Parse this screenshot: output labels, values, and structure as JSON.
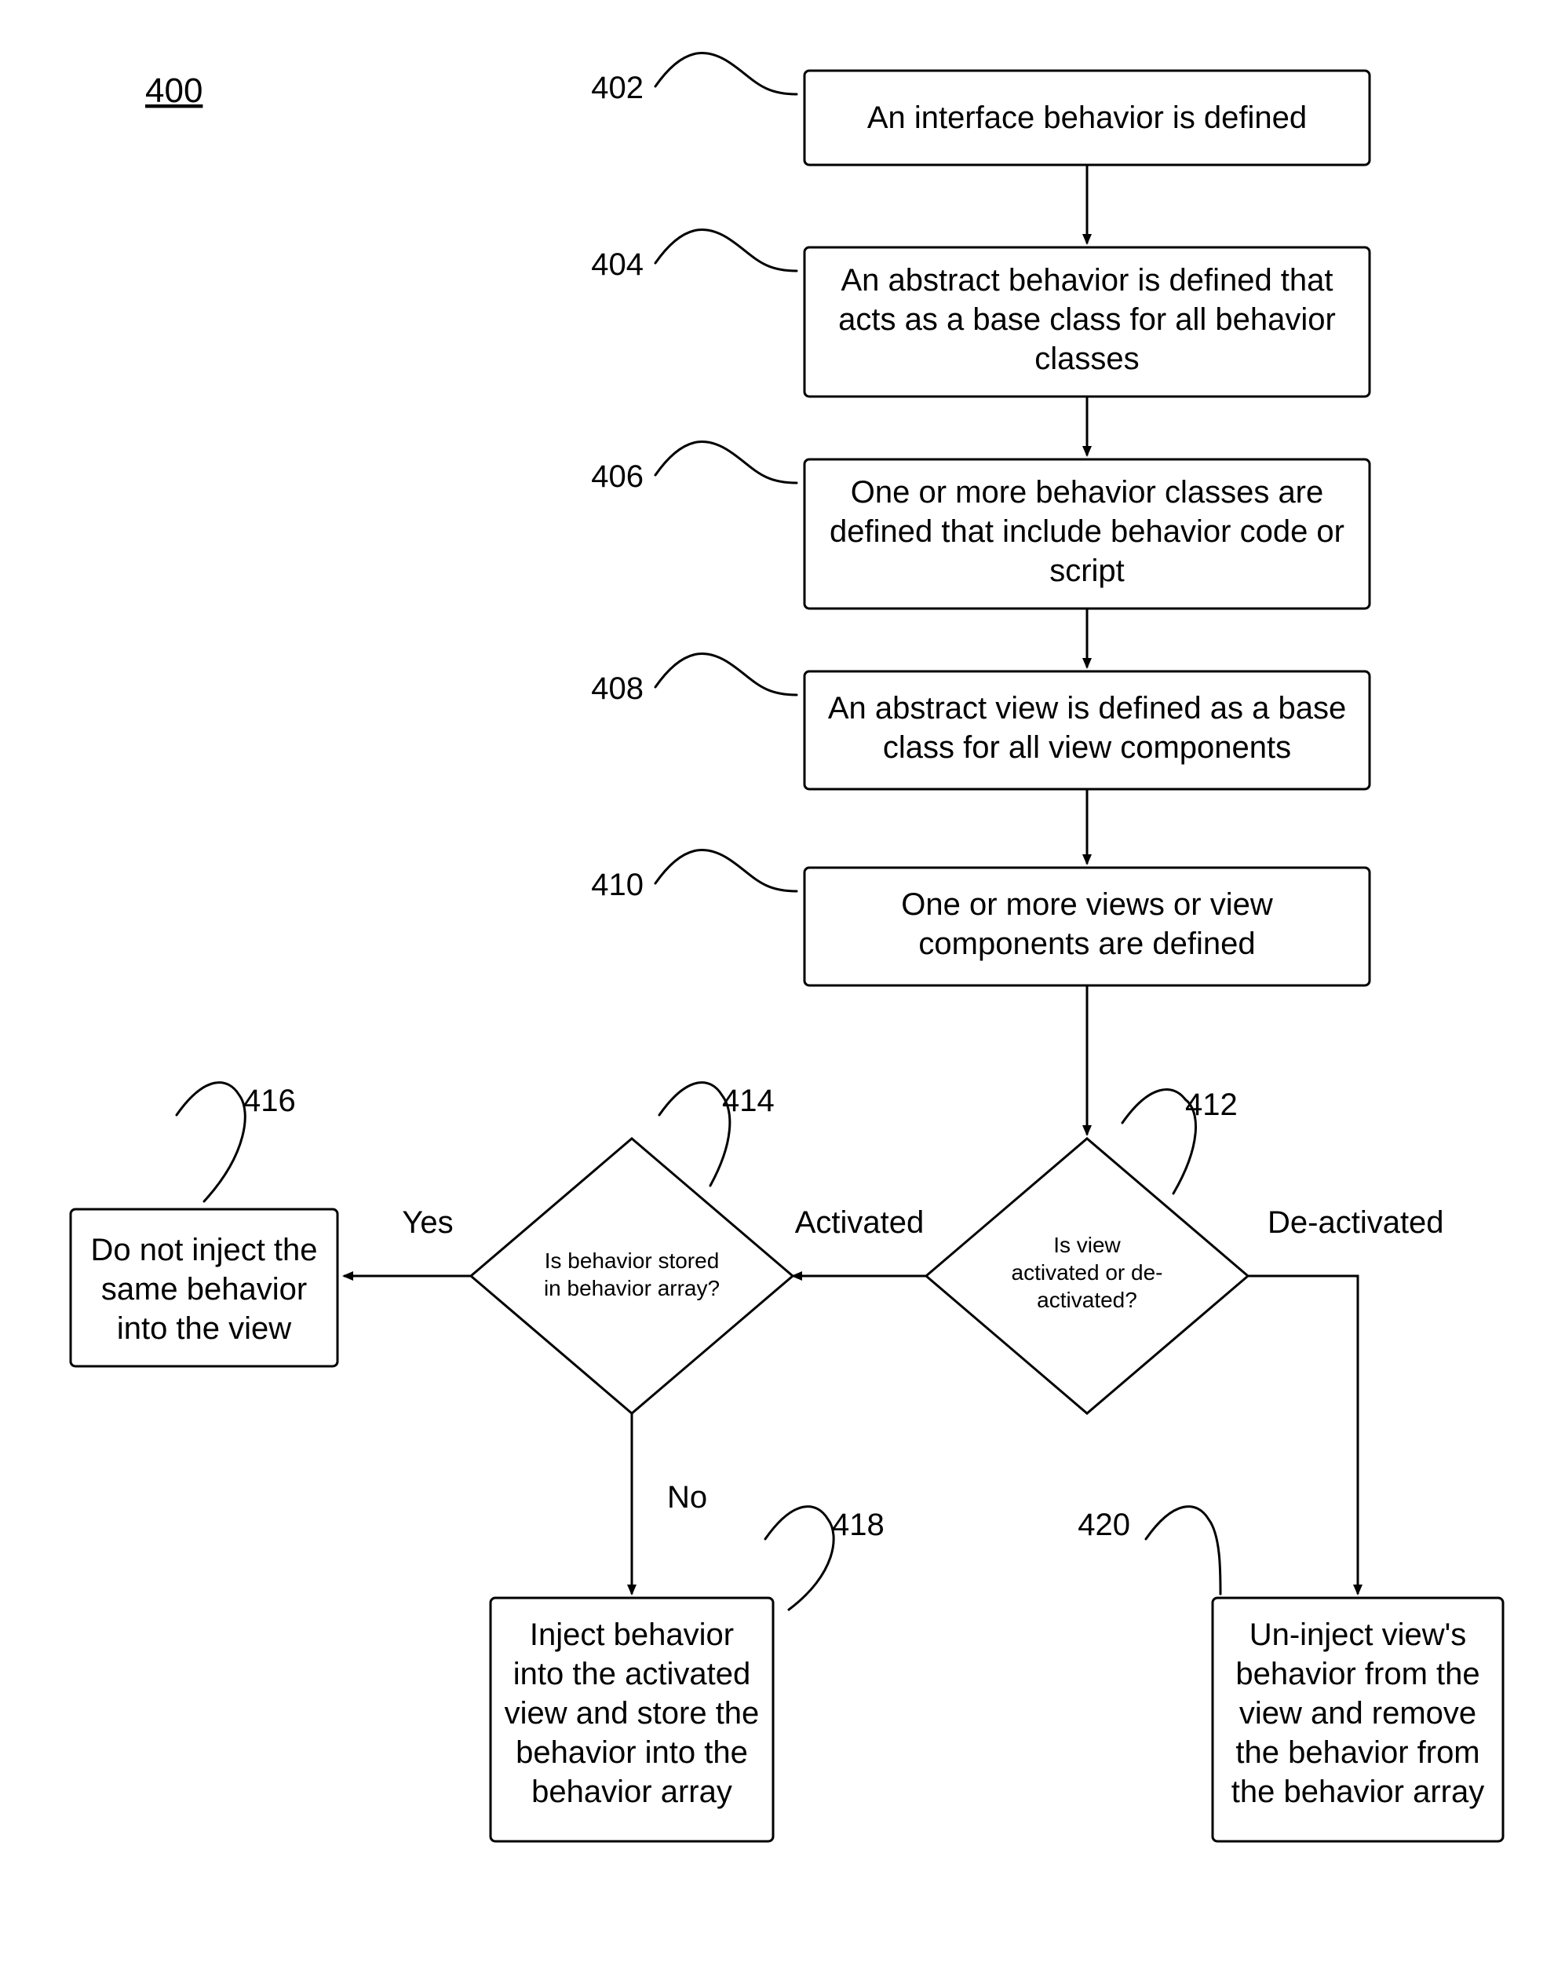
{
  "chart_data": {
    "type": "flowchart",
    "figure_ref": "400",
    "nodes": [
      {
        "id": "402",
        "type": "process",
        "text": "An interface behavior is defined"
      },
      {
        "id": "404",
        "type": "process",
        "text": "An abstract behavior is defined that acts as a base class for all behavior classes"
      },
      {
        "id": "406",
        "type": "process",
        "text": "One or more behavior classes are defined that include behavior code or script"
      },
      {
        "id": "408",
        "type": "process",
        "text": "An abstract view is defined as a base class for all view components"
      },
      {
        "id": "410",
        "type": "process",
        "text": "One or more views or view components are defined"
      },
      {
        "id": "412",
        "type": "decision",
        "text": "Is view activated or de-activated?"
      },
      {
        "id": "414",
        "type": "decision",
        "text": "Is behavior stored in behavior array?"
      },
      {
        "id": "416",
        "type": "process",
        "text": "Do not inject the same behavior into the view"
      },
      {
        "id": "418",
        "type": "process",
        "text": "Inject behavior into the activated view and store the behavior into the behavior array"
      },
      {
        "id": "420",
        "type": "process",
        "text": "Un-inject view's behavior from the view and remove the behavior from the behavior array"
      }
    ],
    "edges": [
      {
        "from": "402",
        "to": "404",
        "label": ""
      },
      {
        "from": "404",
        "to": "406",
        "label": ""
      },
      {
        "from": "406",
        "to": "408",
        "label": ""
      },
      {
        "from": "408",
        "to": "410",
        "label": ""
      },
      {
        "from": "410",
        "to": "412",
        "label": ""
      },
      {
        "from": "412",
        "to": "414",
        "label": "Activated"
      },
      {
        "from": "412",
        "to": "420",
        "label": "De-activated"
      },
      {
        "from": "414",
        "to": "416",
        "label": "Yes"
      },
      {
        "from": "414",
        "to": "418",
        "label": "No"
      }
    ]
  },
  "labels": {
    "fig": "400",
    "n402": "402",
    "n404": "404",
    "n406": "406",
    "n408": "408",
    "n410": "410",
    "n412": "412",
    "n414": "414",
    "n416": "416",
    "n418": "418",
    "n420": "420",
    "yes": "Yes",
    "no": "No",
    "activated": "Activated",
    "deactivated": "De-activated"
  },
  "texts": {
    "t402_l1": "An interface behavior is defined",
    "t404_l1": "An abstract behavior is defined that",
    "t404_l2": "acts as a base class for all behavior",
    "t404_l3": "classes",
    "t406_l1": "One or more behavior classes are",
    "t406_l2": "defined that include behavior code or",
    "t406_l3": "script",
    "t408_l1": "An abstract view is defined as a base",
    "t408_l2": "class for all view components",
    "t410_l1": "One or more views or view",
    "t410_l2": "components are defined",
    "t412_l1": "Is view",
    "t412_l2": "activated or de-",
    "t412_l3": "activated?",
    "t414_l1": "Is behavior stored",
    "t414_l2": "in behavior array?",
    "t416_l1": "Do not inject the",
    "t416_l2": "same behavior",
    "t416_l3": "into the view",
    "t418_l1": "Inject behavior",
    "t418_l2": "into the activated",
    "t418_l3": "view and store the",
    "t418_l4": "behavior into the",
    "t418_l5": "behavior array",
    "t420_l1": "Un-inject view's",
    "t420_l2": "behavior from the",
    "t420_l3": "view and remove",
    "t420_l4": "the behavior from",
    "t420_l5": "the behavior array"
  }
}
